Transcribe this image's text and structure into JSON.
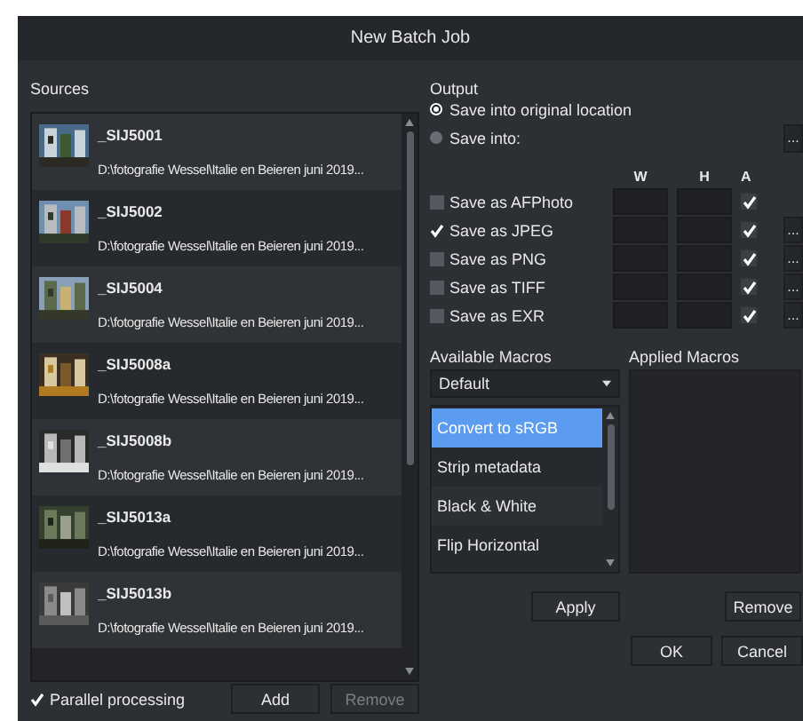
{
  "window": {
    "title": "New Batch Job"
  },
  "sources": {
    "label": "Sources",
    "items": [
      {
        "name": "_SIJ5001",
        "path": "D:\\fotografie Wessel\\Italie en Beieren juni 2019..."
      },
      {
        "name": "_SIJ5002",
        "path": "D:\\fotografie Wessel\\Italie en Beieren juni 2019..."
      },
      {
        "name": "_SIJ5004",
        "path": "D:\\fotografie Wessel\\Italie en Beieren juni 2019..."
      },
      {
        "name": "_SIJ5008a",
        "path": "D:\\fotografie Wessel\\Italie en Beieren juni 2019..."
      },
      {
        "name": "_SIJ5008b",
        "path": "D:\\fotografie Wessel\\Italie en Beieren juni 2019..."
      },
      {
        "name": "_SIJ5013a",
        "path": "D:\\fotografie Wessel\\Italie en Beieren juni 2019..."
      },
      {
        "name": "_SIJ5013b",
        "path": "D:\\fotografie Wessel\\Italie en Beieren juni 2019..."
      }
    ]
  },
  "parallel_processing": {
    "label": "Parallel processing",
    "checked": true
  },
  "source_buttons": [
    {
      "label": "Add",
      "disabled": false
    },
    {
      "label": "Remove",
      "disabled": true
    }
  ],
  "output": {
    "label": "Output",
    "browse_button": "...",
    "locations": [
      {
        "label": "Save into original location",
        "selected": true
      },
      {
        "label": "Save into:",
        "selected": false
      }
    ],
    "columns": [
      "W",
      "H",
      "A"
    ],
    "formats": [
      {
        "label": "Save as AFPhoto",
        "checked": false,
        "a_checked": true
      },
      {
        "label": "Save as JPEG",
        "checked": true,
        "a_checked": true,
        "options_button": "..."
      },
      {
        "label": "Save as PNG",
        "checked": false,
        "a_checked": true,
        "options_button": "..."
      },
      {
        "label": "Save as TIFF",
        "checked": false,
        "a_checked": true,
        "options_button": "..."
      },
      {
        "label": "Save as EXR",
        "checked": false,
        "a_checked": true,
        "options_button": "..."
      }
    ]
  },
  "available_macros": {
    "label": "Available Macros",
    "dropdown": "Default",
    "items": [
      {
        "label": "Convert to sRGB",
        "selected": true
      },
      {
        "label": "Strip metadata",
        "selected": false
      },
      {
        "label": "Black & White",
        "selected": false
      },
      {
        "label": "Flip Horizontal",
        "selected": false
      }
    ]
  },
  "applied_macros": {
    "label": "Applied Macros"
  },
  "macro_buttons": [
    "Apply",
    "Remove"
  ],
  "dialog_buttons": [
    "OK",
    "Cancel"
  ]
}
